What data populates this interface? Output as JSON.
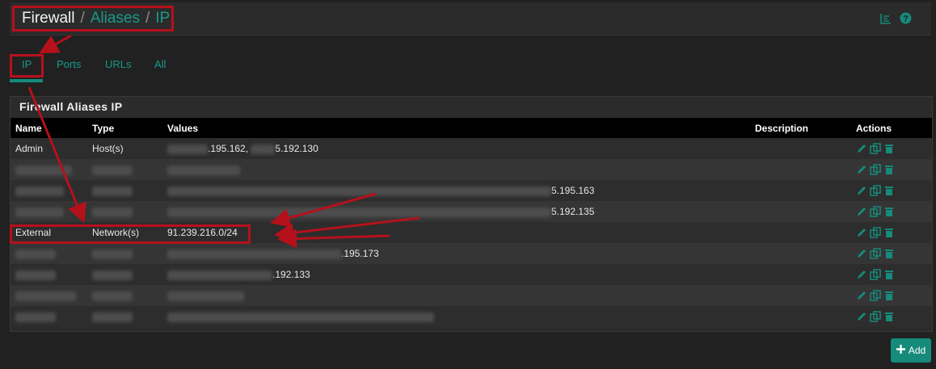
{
  "breadcrumb": {
    "first": "Firewall",
    "second": "Aliases",
    "third": "IP",
    "separator": "/"
  },
  "tabs": [
    {
      "label": "IP"
    },
    {
      "label": "Ports"
    },
    {
      "label": "URLs"
    },
    {
      "label": "All"
    }
  ],
  "panel": {
    "title": "Firewall Aliases IP"
  },
  "table": {
    "headers": {
      "name": "Name",
      "type": "Type",
      "values": "Values",
      "description": "Description",
      "actions": "Actions"
    },
    "rows": [
      {
        "name": "Admin",
        "type": "Host(s)",
        "values_a": ".195.162,",
        "values_b": "5.192.130"
      },
      {
        "name": "",
        "type": "",
        "values_a": ""
      },
      {
        "name": "",
        "type": "",
        "values_a": "5.195.163"
      },
      {
        "name": "",
        "type": "",
        "values_a": "5.192.135"
      },
      {
        "name": "External",
        "type": "Network(s)",
        "values_a": "91.239.216.0/24"
      },
      {
        "name": "",
        "type": "",
        "values_a": ".195.173"
      },
      {
        "name": "",
        "type": "",
        "values_a": ".192.133"
      },
      {
        "name": "",
        "type": "",
        "values_a": ""
      },
      {
        "name": "",
        "type": "",
        "values_a": ""
      }
    ]
  },
  "add_button": {
    "label": "Add"
  },
  "colors": {
    "accent": "#168a7b",
    "annotation": "#b5111b"
  }
}
